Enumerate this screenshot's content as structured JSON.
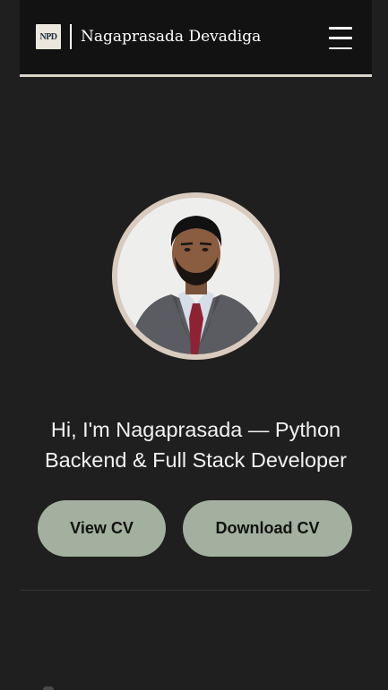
{
  "header": {
    "logo_text": "NPD",
    "brand_name": "Nagaprasada Devadiga",
    "menu_icon": "hamburger-menu-icon"
  },
  "hero": {
    "avatar_icon": "profile-photo",
    "headline": "Hi, I'm Nagaprasada — Python Backend & Full Stack Developer",
    "view_cv_label": "View CV",
    "download_cv_label": "Download CV"
  },
  "colors": {
    "background": "#1f1f1f",
    "navbar": "#121212",
    "accent_border": "#d9d2c9",
    "button": "#a3b09f",
    "avatar_ring": "#d9cbbd"
  }
}
